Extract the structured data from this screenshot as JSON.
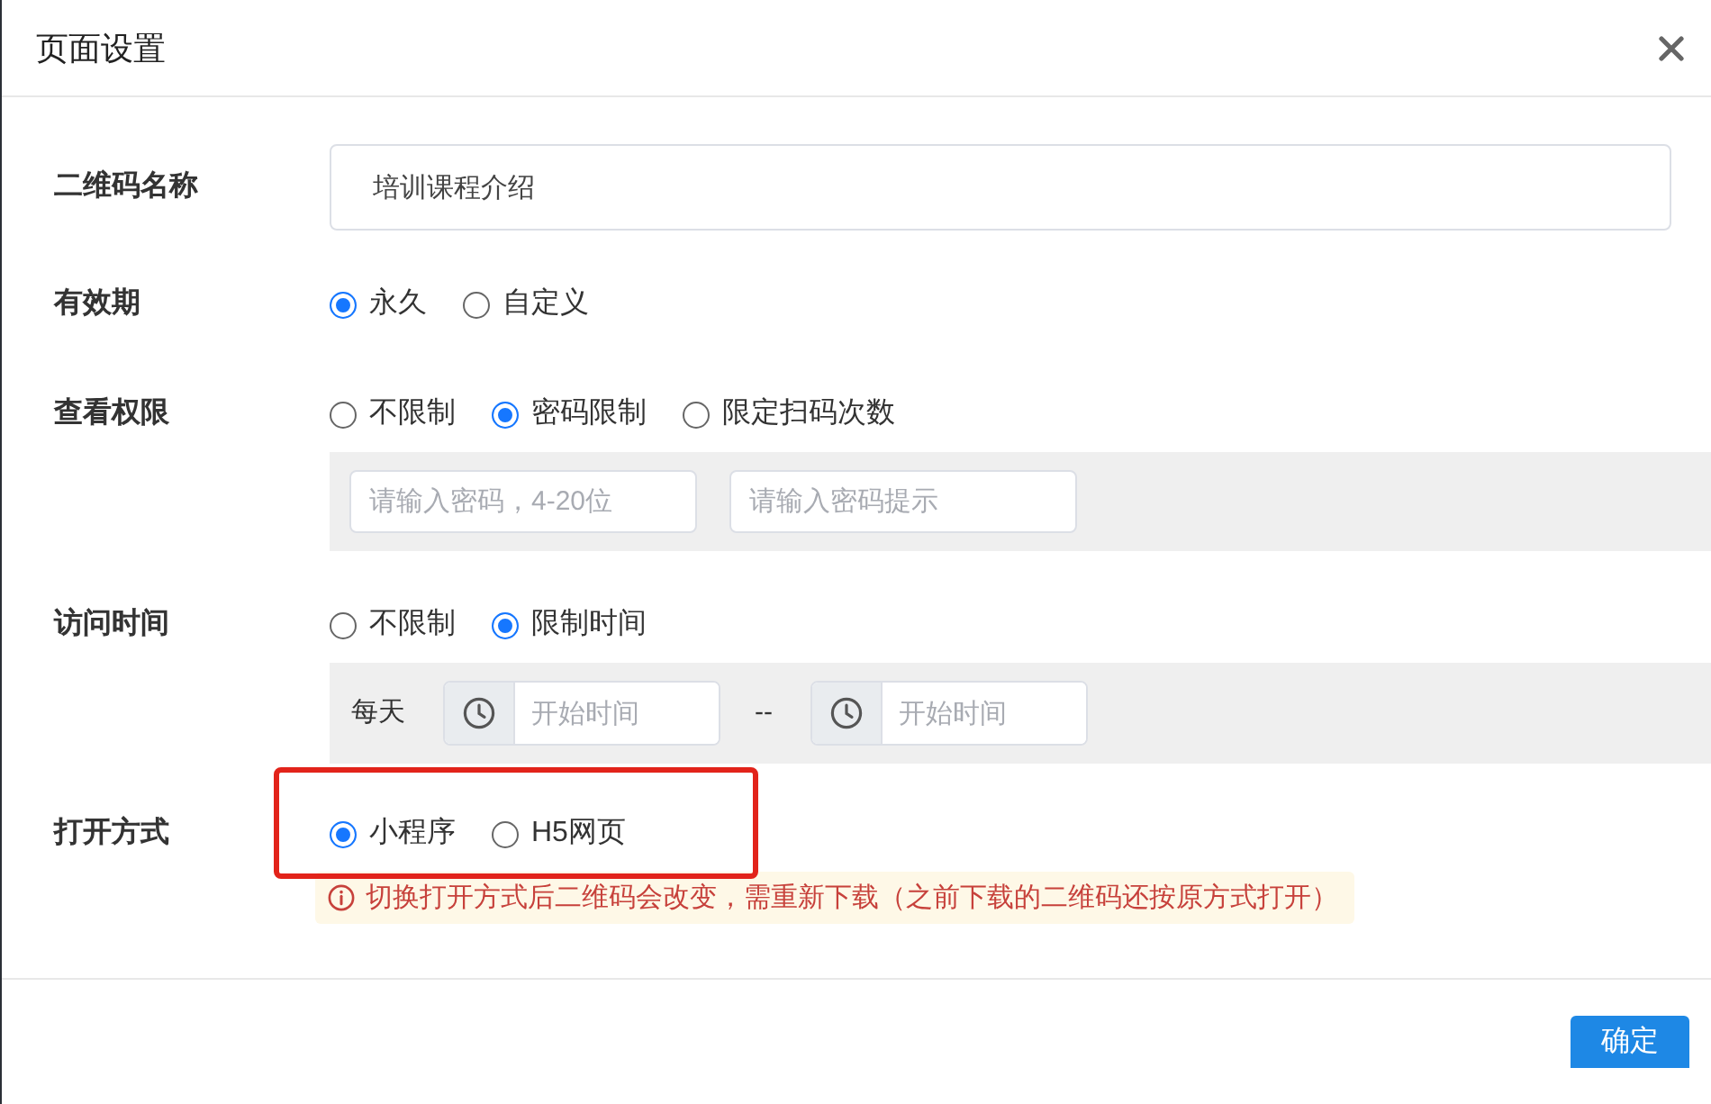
{
  "dialog": {
    "title": "页面设置"
  },
  "fields": [
    {
      "kind": "text",
      "label": "二维码名称",
      "value": "培训课程介绍"
    },
    {
      "kind": "radio",
      "label": "有效期",
      "options": [
        {
          "label": "永久",
          "selected": true
        },
        {
          "label": "自定义",
          "selected": false
        }
      ]
    },
    {
      "kind": "radio",
      "label": "查看权限",
      "options": [
        {
          "label": "不限制",
          "selected": false
        },
        {
          "label": "密码限制",
          "selected": true
        },
        {
          "label": "限定扫码次数",
          "selected": false
        }
      ],
      "panel": {
        "items": [
          {
            "kind": "input",
            "placeholder": "请输入密码，4-20位"
          },
          {
            "kind": "input",
            "placeholder": "请输入密码提示"
          }
        ]
      }
    },
    {
      "kind": "radio",
      "label": "访问时间",
      "options": [
        {
          "label": "不限制",
          "selected": false
        },
        {
          "label": "限制时间",
          "selected": true
        }
      ],
      "panel": {
        "items": [
          {
            "kind": "text",
            "text": "每天"
          },
          {
            "kind": "time",
            "placeholder": "开始时间"
          },
          {
            "kind": "text",
            "text": "--"
          },
          {
            "kind": "time",
            "placeholder": "开始时间"
          }
        ]
      }
    },
    {
      "kind": "radio",
      "label": "打开方式",
      "highlighted": true,
      "options": [
        {
          "label": "小程序",
          "selected": true
        },
        {
          "label": "H5网页",
          "selected": false
        }
      ],
      "warning": "切换打开方式后二维码会改变，需重新下载（之前下载的二维码还按原方式打开）"
    }
  ],
  "footer": {
    "buttons": [
      "确定"
    ]
  }
}
